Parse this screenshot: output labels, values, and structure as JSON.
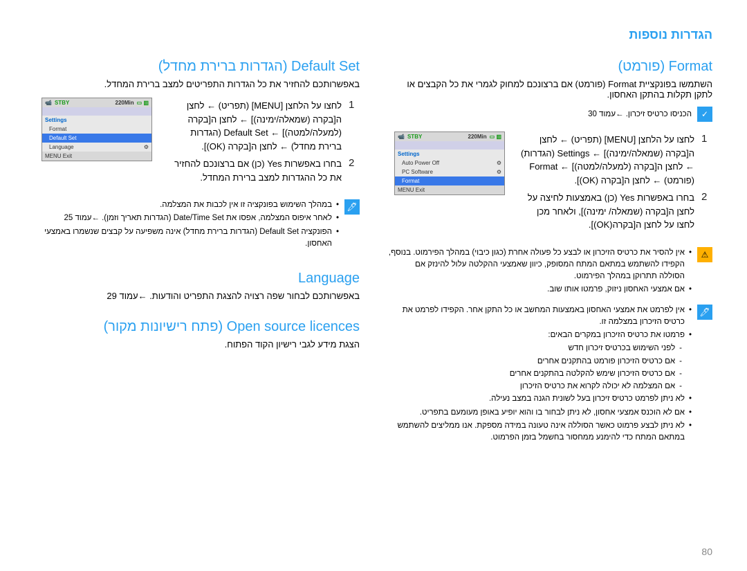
{
  "header": "הגדרות נוספות",
  "right": {
    "format_title": "Format (פורמט)",
    "format_desc": "השתמשו בפונקציית Format (פורמט) אם ברצונכם למחוק לגמרי את כל הקבצים או לתקן תקלות בהתקן האחסון.",
    "note1": "הכניסו כרטיס זיכרון. ←עמוד 30",
    "step1": "לחצו על הלחצן [MENU] (תפריט) ← לחצן ה[בקרה (שמאלה/ימינה)] ← Settings (הגדרות) ← לחצן ה[בקרה (למעלה/למטה)] ← Format (פורמט) ← לחצן ה[בקרה (OK)].",
    "step2": "בחרו באפשרות Yes (כן) באמצעות לחיצה על לחצן ה[בקרה (שמאלה/ ימינה)], ולאחר מכן לחצו על לחצן ה[בקרה(OK)].",
    "warn_bullets": [
      "אין להסיר את כרטיס הזיכרון או לבצע כל פעולה אחרת (כגון כיבוי) במהלך הפירמוט. בנוסף, הקפידו להשתמש במתאם המתח המסופק, כיוון שאמצעי ההקלטה עלול להינזק אם הסוללה תתרוקן במהלך הפירמוט.",
      "אם אמצעי האחסון ניזוק, פרמטו אותו שוב."
    ],
    "info_bullets": [
      "אין לפרמט את אמצעי האחסון באמצעות המחשב או כל התקן אחר. הקפידו לפרמט את כרטיס הזיכרון במצלמה זו.",
      "פרמטו את כרטיס הזיכרון במקרים הבאים:"
    ],
    "info_subs": [
      "לפני השימוש בכרטיס זיכרון חדש",
      "אם כרטיס הזיכרון פורמט בהתקנים אחרים",
      "אם כרטיס הזיכרון שימש להקלטה בהתקנים אחרים",
      "אם המצלמה לא יכולה לקרוא את כרטיס הזיכרון"
    ],
    "info_bullets2": [
      "לא ניתן לפרמט כרטיס זיכרון בעל לשונית הגנה במצב נעילה.",
      "אם לא הוכנס אמצעי אחסון, לא ניתן לבחור בו והוא יופיע באופן מעומעם בתפריט.",
      "לא ניתן לבצע פרמוט כאשר הסוללה אינה טעונה במידה מספקת. אנו ממליצים להשתמש במתאם המתח כדי להימנע ממחסור בחשמל בזמן הפרמוט."
    ],
    "screen": {
      "stby": "STBY",
      "time": "220Min",
      "side": "Settings",
      "items": [
        "Auto Power Off",
        "PC Software",
        "Format"
      ],
      "exit": "MENU Exit"
    }
  },
  "left": {
    "default_title": "Default Set (הגדרות ברירת מחדל)",
    "default_desc": "באפשרותכם להחזיר את כל הגדרות התפריטים למצב ברירת המחדל.",
    "step1": "לחצו על הלחצן [MENU] (תפריט) ← לחצן ה[בקרה (שמאלה/ימינה)] ← לחצן ה[בקרה (למעלה/למטה)] ← Default Set (הגדרות ברירת מחדל) ← לחצן ה[בקרה (OK)].",
    "step2": "בחרו באפשרות Yes (כן) אם ברצונכם להחזיר את כל ההגדרות למצב ברירת המחדל.",
    "info_bullets": [
      "במהלך השימוש בפונקציה זו אין לכבות את המצלמה.",
      "לאחר איפוס המצלמה, אפסו את Date/Time Set (הגדרות תאריך וזמן). ←עמוד 25",
      "הפונקציה Default Set (הגדרות ברירת מחדל) אינה משפיעה על קבצים שנשמרו באמצעי האחסון."
    ],
    "language_title": "Language",
    "language_desc": "באפשרותכם לבחור שפה רצויה להצגת התפריט והודעות. ←עמוד 29",
    "licences_title": "Open source licences (פתח רישיונות מקור)",
    "licences_desc": "הצגת מידע לגבי רישיון הקוד הפתוח.",
    "screen": {
      "stby": "STBY",
      "time": "220Min",
      "side": "Settings",
      "items": [
        "Format",
        "Default Set",
        "Language"
      ],
      "exit": "MENU Exit"
    }
  },
  "page_number": "80"
}
